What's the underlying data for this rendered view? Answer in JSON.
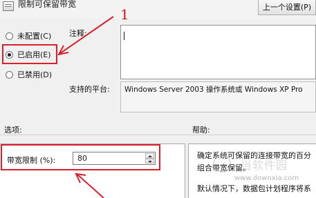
{
  "window": {
    "title": "限制可保留带宽",
    "prev_setting_button": "上一个设置(P)"
  },
  "state": {
    "options": [
      {
        "label": "未配置(C)",
        "checked": false
      },
      {
        "label": "已启用(E)",
        "checked": true
      },
      {
        "label": "已禁用(D)",
        "checked": false
      }
    ]
  },
  "comment": {
    "label": "注释:",
    "value": ""
  },
  "platform": {
    "label": "支持的平台:",
    "value": "Windows Server 2003 操作系统或 Windows XP Pro"
  },
  "sections": {
    "options_label": "选项:",
    "help_label": "帮助:"
  },
  "bandwidth": {
    "label": "带宽限制 (%):",
    "value": "80"
  },
  "help": {
    "lines": [
      "确定系统可保留的连接带宽的百分",
      "组合带宽保留。",
      "默认情况下，数据包计划程序将系"
    ]
  },
  "annotation": {
    "number": "1"
  },
  "watermark": {
    "site": "www.downxia.com",
    "name": "当软件园"
  },
  "colors": {
    "annotation_red": "#d9202a",
    "background": "#f0f0f0"
  }
}
